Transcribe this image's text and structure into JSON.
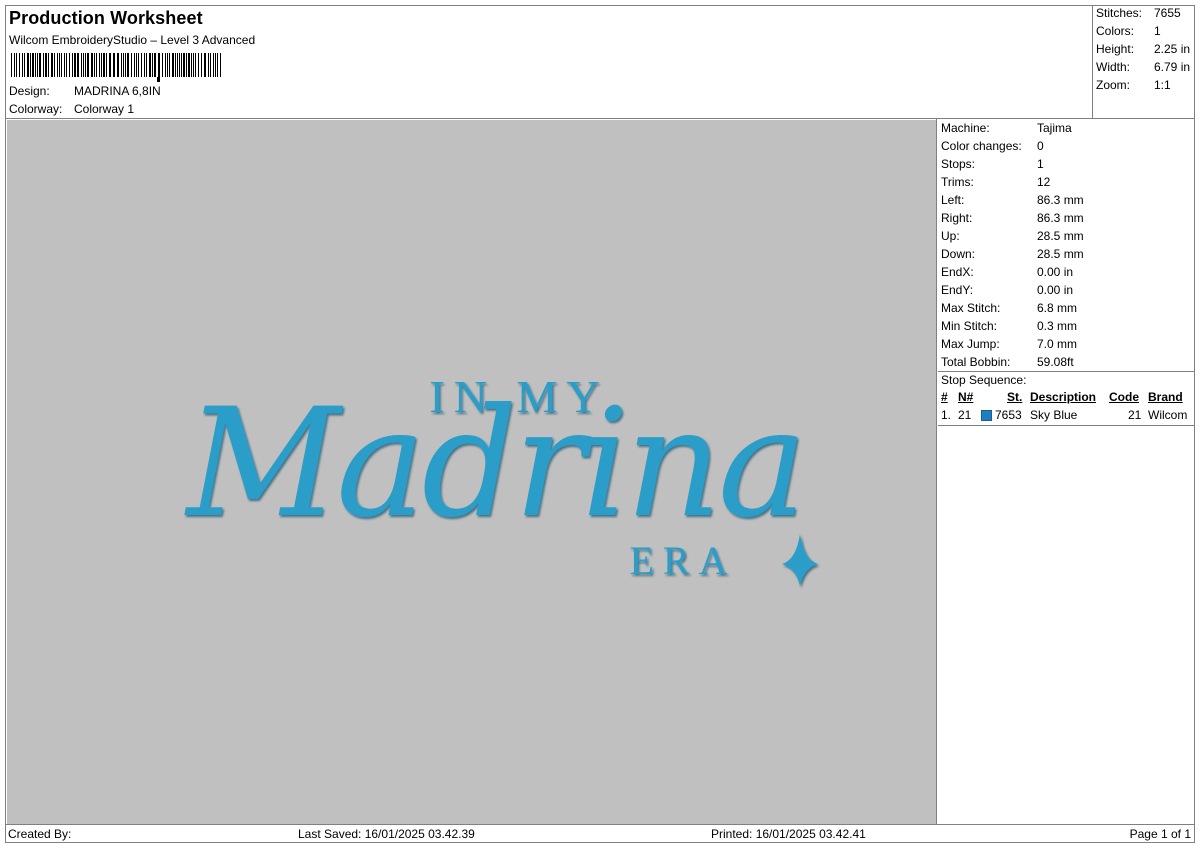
{
  "header": {
    "title": "Production Worksheet",
    "subtitle": "Wilcom EmbroideryStudio – Level 3 Advanced",
    "design_label": "Design:",
    "design_value": "MADRINA 6,8IN",
    "colorway_label": "Colorway:",
    "colorway_value": "Colorway 1"
  },
  "summary": [
    {
      "label": "Stitches:",
      "value": "7655"
    },
    {
      "label": "Colors:",
      "value": "1"
    },
    {
      "label": "Height:",
      "value": "2.25 in"
    },
    {
      "label": "Width:",
      "value": "6.79 in"
    },
    {
      "label": "Zoom:",
      "value": "1:1"
    }
  ],
  "design": {
    "line1": "IN MY",
    "line2": "Madrina",
    "line3": "ERA",
    "thread_color": "#2a9dc8",
    "background_color": "#c0c0c0"
  },
  "info": [
    {
      "label": "Machine:",
      "value": "Tajima"
    },
    {
      "label": "Color changes:",
      "value": "0"
    },
    {
      "label": "Stops:",
      "value": "1"
    },
    {
      "label": "Trims:",
      "value": "12"
    },
    {
      "label": "Left:",
      "value": "86.3 mm"
    },
    {
      "label": "Right:",
      "value": "86.3 mm"
    },
    {
      "label": "Up:",
      "value": "28.5 mm"
    },
    {
      "label": "Down:",
      "value": "28.5 mm"
    },
    {
      "label": "EndX:",
      "value": "0.00 in"
    },
    {
      "label": "EndY:",
      "value": "0.00 in"
    },
    {
      "label": "Max Stitch:",
      "value": "6.8 mm"
    },
    {
      "label": "Min Stitch:",
      "value": "0.3 mm"
    },
    {
      "label": "Max Jump:",
      "value": "7.0 mm"
    },
    {
      "label": "Total Bobbin:",
      "value": "59.08ft"
    }
  ],
  "stop_sequence": {
    "heading": "Stop Sequence:",
    "columns": {
      "num": "#",
      "n": "N#",
      "st": "St.",
      "description": "Description",
      "code": "Code",
      "brand": "Brand"
    },
    "rows": [
      {
        "num": "1.",
        "n": "21",
        "st": "7653",
        "description": "Sky Blue",
        "code": "21",
        "brand": "Wilcom",
        "color": "#1e7fc0"
      }
    ]
  },
  "footer": {
    "created_by": "Created By:",
    "last_saved": "Last Saved: 16/01/2025 03.42.39",
    "printed": "Printed: 16/01/2025 03.42.41",
    "page": "Page 1 of 1"
  }
}
